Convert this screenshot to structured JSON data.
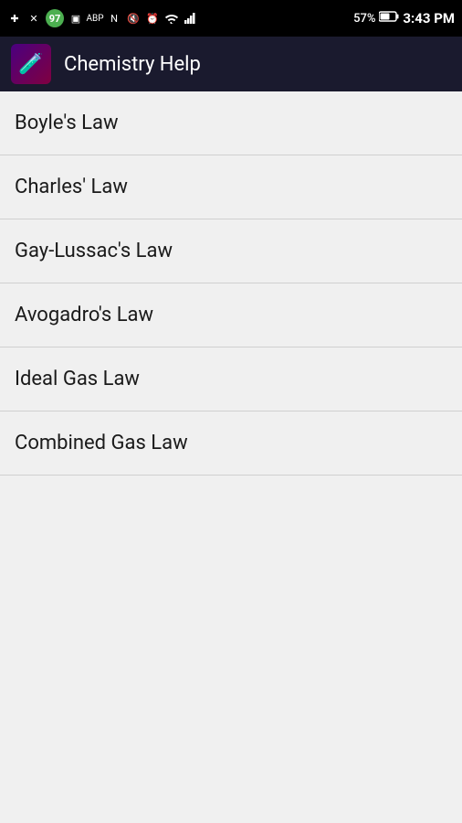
{
  "statusBar": {
    "time": "3:43 PM",
    "battery": "57%",
    "badgeCount": "97"
  },
  "appBar": {
    "title": "Chemistry Help",
    "icon": "🧪"
  },
  "menuItems": [
    {
      "id": "boyles-law",
      "label": "Boyle's Law"
    },
    {
      "id": "charles-law",
      "label": "Charles' Law"
    },
    {
      "id": "gay-lussac-law",
      "label": "Gay-Lussac's Law"
    },
    {
      "id": "avogadro-law",
      "label": "Avogadro's Law"
    },
    {
      "id": "ideal-gas-law",
      "label": "Ideal Gas Law"
    },
    {
      "id": "combined-gas-law",
      "label": "Combined Gas Law"
    }
  ]
}
